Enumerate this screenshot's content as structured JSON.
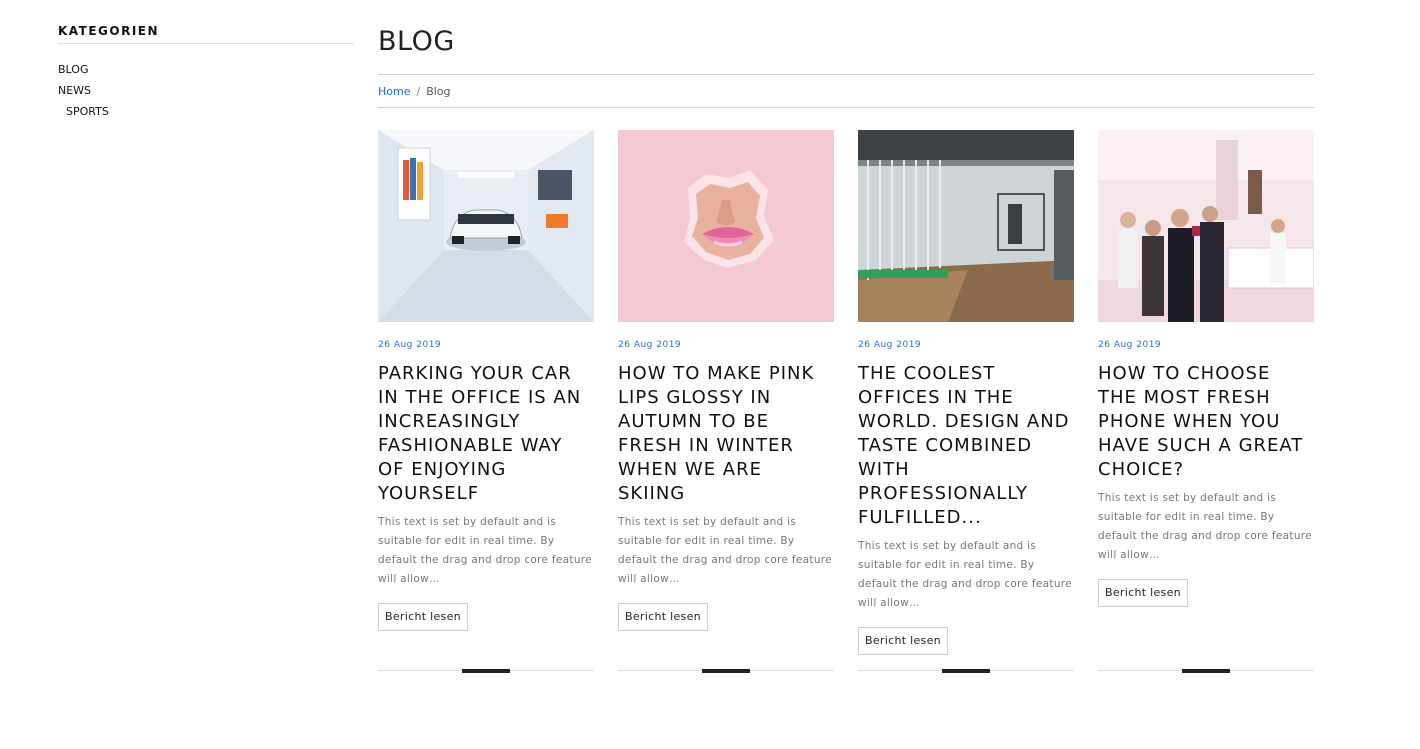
{
  "sidebar": {
    "title": "KATEGORIEN",
    "items": [
      {
        "label": "BLOG"
      },
      {
        "label": "NEWS"
      },
      {
        "label": "SPORTS"
      }
    ]
  },
  "page": {
    "title": "BLOG"
  },
  "breadcrumb": {
    "home": "Home",
    "separator": "/",
    "current": "Blog"
  },
  "posts": [
    {
      "image": "car-showroom-image",
      "date": "26 Aug 2019",
      "title": "PARKING YOUR CAR IN THE OFFICE IS AN INCREASINGLY FASHIONABLE WAY OF ENJOYING YOURSELF",
      "excerpt": "This text is set by default and is suitable for edit in real time. By default the drag and drop core feature will allow…",
      "button": "Bericht lesen"
    },
    {
      "image": "pink-lips-image",
      "date": "26 Aug 2019",
      "title": "HOW TO MAKE PINK LIPS GLOSSY IN AUTUMN TO BE FRESH IN WINTER WHEN WE ARE SKIING",
      "excerpt": "This text is set by default and is suitable for edit in real time. By default the drag and drop core feature will allow…",
      "button": "Bericht lesen"
    },
    {
      "image": "office-interior-image",
      "date": "26 Aug 2019",
      "title": "THE COOLEST OFFICES IN THE WORLD. DESIGN AND TASTE COMBINED WITH PROFESSIONALLY FULFILLED...",
      "excerpt": "This text is set by default and is suitable for edit in real time. By default the drag and drop core feature will allow…",
      "button": "Bericht lesen"
    },
    {
      "image": "phone-store-image",
      "date": "26 Aug 2019",
      "title": "HOW TO CHOOSE THE MOST FRESH PHONE WHEN YOU HAVE SUCH A GREAT CHOICE?",
      "excerpt": "This text is set by default and is suitable for edit in real time. By default the drag and drop core feature will allow…",
      "button": "Bericht lesen"
    }
  ],
  "colors": {
    "link": "#1c6fd6",
    "text": "#111111",
    "muted": "#777777",
    "rule": "#cfcfcf"
  }
}
